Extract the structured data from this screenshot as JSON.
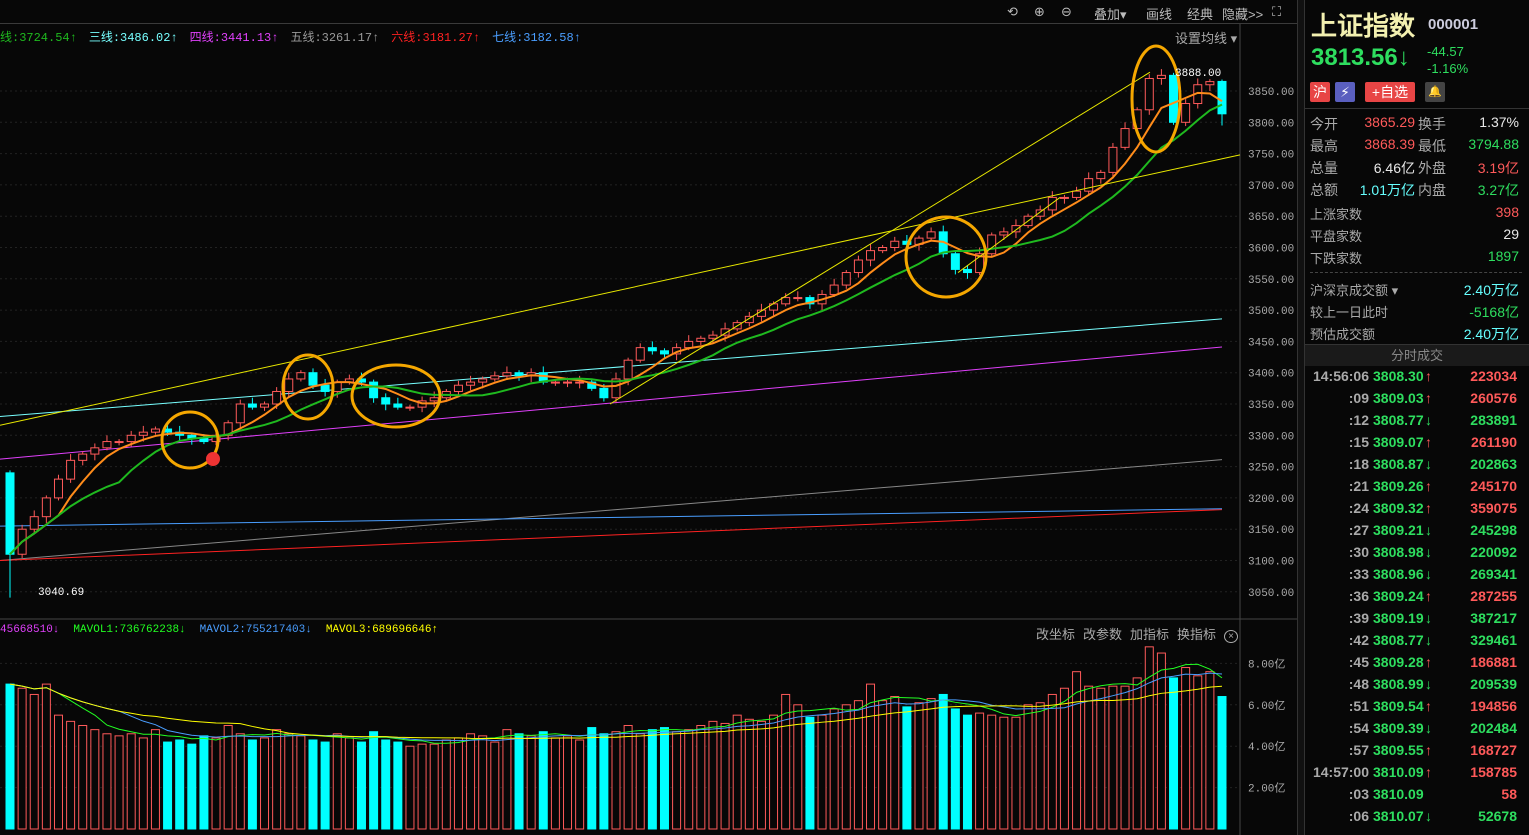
{
  "toolbar": {
    "undo": "⟲",
    "zoom_in": "⊕",
    "zoom_out": "⊖",
    "overlay": "叠加▾",
    "draw": "画线",
    "classic": "经典",
    "hide": "隐藏>>",
    "fullscreen": "⛶"
  },
  "ma_legend": [
    {
      "label": "线:3724.54↑",
      "color": "#1fb91f"
    },
    {
      "label": "三线:3486.02↑",
      "color": "#7ff"
    },
    {
      "label": "四线:3441.13↑",
      "color": "#e040fb"
    },
    {
      "label": "五线:3261.17↑",
      "color": "#999"
    },
    {
      "label": "六线:3181.27↑",
      "color": "#f22"
    },
    {
      "label": "七线:3182.58↑",
      "color": "#4a9eff"
    }
  ],
  "set_ma": "设置均线 ▾",
  "annotations": {
    "high": "3888.00",
    "low": "3040.69"
  },
  "price_axis": [
    "3850.00",
    "3800.00",
    "3750.00",
    "3700.00",
    "3650.00",
    "3600.00",
    "3550.00",
    "3500.00",
    "3450.00",
    "3400.00",
    "3350.00",
    "3300.00",
    "3250.00",
    "3200.00",
    "3150.00",
    "3100.00",
    "3050.00"
  ],
  "volume_header": [
    {
      "label": "45668510↓",
      "color": "#e040fb"
    },
    {
      "label": "MAVOL1:736762238↓",
      "color": "#2f2"
    },
    {
      "label": "MAVOL2:755217403↓",
      "color": "#4a9eff"
    },
    {
      "label": "MAVOL3:689696646↑",
      "color": "#ff0"
    }
  ],
  "volume_tools": [
    "改坐标",
    "改参数",
    "加指标",
    "换指标"
  ],
  "volume_axis": [
    "8.00亿",
    "6.00亿",
    "4.00亿",
    "2.00亿"
  ],
  "colors": {
    "up": "#ff5a5a",
    "down": "#00ffff",
    "ma5": "#ff8c1a",
    "ma10": "#1fb91f",
    "trend": "#e8e800",
    "circle": "#f5a700"
  },
  "chart_data": {
    "type": "candlestick",
    "ylim": [
      3020,
      3900
    ],
    "closes": [
      3110,
      3150,
      3170,
      3200,
      3230,
      3260,
      3270,
      3280,
      3290,
      3290,
      3300,
      3305,
      3310,
      3305,
      3300,
      3295,
      3290,
      3300,
      3320,
      3350,
      3345,
      3350,
      3370,
      3390,
      3400,
      3380,
      3370,
      3385,
      3390,
      3385,
      3360,
      3350,
      3345,
      3345,
      3355,
      3360,
      3370,
      3380,
      3385,
      3390,
      3395,
      3400,
      3395,
      3400,
      3385,
      3385,
      3385,
      3385,
      3375,
      3360,
      3390,
      3420,
      3440,
      3435,
      3430,
      3440,
      3450,
      3455,
      3460,
      3470,
      3480,
      3490,
      3500,
      3510,
      3520,
      3520,
      3510,
      3525,
      3540,
      3560,
      3580,
      3595,
      3600,
      3610,
      3605,
      3615,
      3625,
      3590,
      3565,
      3560,
      3590,
      3620,
      3625,
      3635,
      3650,
      3660,
      3680,
      3680,
      3690,
      3710,
      3720,
      3760,
      3790,
      3820,
      3870,
      3875,
      3800,
      3830,
      3860,
      3865,
      3813.56
    ],
    "first_open": 3240,
    "last_candle": {
      "open": 3865.29,
      "high": 3868.39,
      "low": 3794.88,
      "close": 3813.56
    },
    "volumes": [
      7,
      6.8,
      6.5,
      7,
      5.5,
      5.2,
      5,
      4.8,
      4.6,
      4.5,
      4.6,
      4.4,
      4.8,
      4.2,
      4.3,
      4.1,
      4.5,
      4.4,
      5,
      4.6,
      4.3,
      4.4,
      4.8,
      4.6,
      4.5,
      4.3,
      4.2,
      4.6,
      4.4,
      4.2,
      4.7,
      4.3,
      4.2,
      4.0,
      4.1,
      4.1,
      4.3,
      4.4,
      4.6,
      4.5,
      4.2,
      4.8,
      4.6,
      4.5,
      4.7,
      4.4,
      4.5,
      4.3,
      4.9,
      4.6,
      4.7,
      5,
      4.6,
      4.8,
      4.9,
      4.7,
      4.8,
      5,
      5.2,
      5.1,
      5.5,
      5.3,
      5.2,
      5.5,
      6.5,
      6,
      5.4,
      5.5,
      5.8,
      6,
      6.2,
      7,
      6.2,
      6.4,
      5.9,
      6.1,
      6.3,
      6.5,
      5.8,
      5.5,
      5.6,
      5.5,
      5.4,
      5.4,
      6,
      6.1,
      6.5,
      6.8,
      7.6,
      6.9,
      6.8,
      6.9,
      6.9,
      7.3,
      8.8,
      8.5,
      7.3,
      7.8,
      7.4,
      7.6,
      6.4
    ],
    "long_ma": [
      {
        "name": "三线",
        "from": 3330,
        "to": 3486.02,
        "color": "#7ff"
      },
      {
        "name": "四线",
        "from": 3262,
        "to": 3441.13,
        "color": "#e040fb"
      },
      {
        "name": "五线",
        "from": 3100,
        "to": 3261.17,
        "color": "#888"
      },
      {
        "name": "六线",
        "from": 3100,
        "to": 3181.27,
        "color": "#f22"
      },
      {
        "name": "七线",
        "from": 3155,
        "to": 3182.58,
        "color": "#4a9eff"
      }
    ],
    "trendlines": [
      {
        "from": 3316,
        "to": 3748
      }
    ]
  },
  "panel": {
    "name": "上证指数",
    "code": "000001",
    "price": "3813.56↓",
    "change": "-44.57",
    "pct": "-1.16%",
    "badges": {
      "market": "沪",
      "flash": "⚡",
      "watch": "+自选",
      "alert": "🔔"
    },
    "stats": [
      {
        "l": "今开",
        "v": "3865.29",
        "vc": "red",
        "l2": "换手",
        "v2": "1.37%",
        "v2c": "white"
      },
      {
        "l": "最高",
        "v": "3868.39",
        "vc": "red",
        "l2": "最低",
        "v2": "3794.88",
        "v2c": "green"
      },
      {
        "l": "总量",
        "v": "6.46亿",
        "vc": "white",
        "l2": "外盘",
        "v2": "3.19亿",
        "v2c": "red"
      },
      {
        "l": "总额",
        "v": "1.01万亿",
        "vc": "cyan",
        "l2": "内盘",
        "v2": "3.27亿",
        "v2c": "green"
      }
    ],
    "wide": [
      {
        "l": "上涨家数",
        "v": "398",
        "c": "red"
      },
      {
        "l": "平盘家数",
        "v": "29",
        "c": "white"
      },
      {
        "l": "下跌家数",
        "v": "1897",
        "c": "green"
      }
    ],
    "turnover": [
      {
        "l": "沪深京成交额 ▾",
        "v": "2.40万亿",
        "c": "cyan"
      },
      {
        "l": "较上一日此时",
        "v": "-5168亿",
        "c": "green"
      },
      {
        "l": "预估成交额",
        "v": "2.40万亿",
        "c": "cyan"
      }
    ],
    "trades_title": "分时成交",
    "trades": [
      [
        "14:56:06",
        "3808.30",
        "↑",
        "223034"
      ],
      [
        ":09",
        "3809.03",
        "↑",
        "260576"
      ],
      [
        ":12",
        "3808.77",
        "↓",
        "283891"
      ],
      [
        ":15",
        "3809.07",
        "↑",
        "261190"
      ],
      [
        ":18",
        "3808.87",
        "↓",
        "202863"
      ],
      [
        ":21",
        "3809.26",
        "↑",
        "245170"
      ],
      [
        ":24",
        "3809.32",
        "↑",
        "359075"
      ],
      [
        ":27",
        "3809.21",
        "↓",
        "245298"
      ],
      [
        ":30",
        "3808.98",
        "↓",
        "220092"
      ],
      [
        ":33",
        "3808.96",
        "↓",
        "269341"
      ],
      [
        ":36",
        "3809.24",
        "↑",
        "287255"
      ],
      [
        ":39",
        "3809.19",
        "↓",
        "387217"
      ],
      [
        ":42",
        "3808.77",
        "↓",
        "329461"
      ],
      [
        ":45",
        "3809.28",
        "↑",
        "186881"
      ],
      [
        ":48",
        "3808.99",
        "↓",
        "209539"
      ],
      [
        ":51",
        "3809.54",
        "↑",
        "194856"
      ],
      [
        ":54",
        "3809.39",
        "↓",
        "202484"
      ],
      [
        ":57",
        "3809.55",
        "↑",
        "168727"
      ],
      [
        "14:57:00",
        "3810.09",
        "↑",
        "158785"
      ],
      [
        ":03",
        "3810.09",
        "",
        "58"
      ],
      [
        ":06",
        "3810.07",
        "↓",
        "52678"
      ]
    ]
  }
}
